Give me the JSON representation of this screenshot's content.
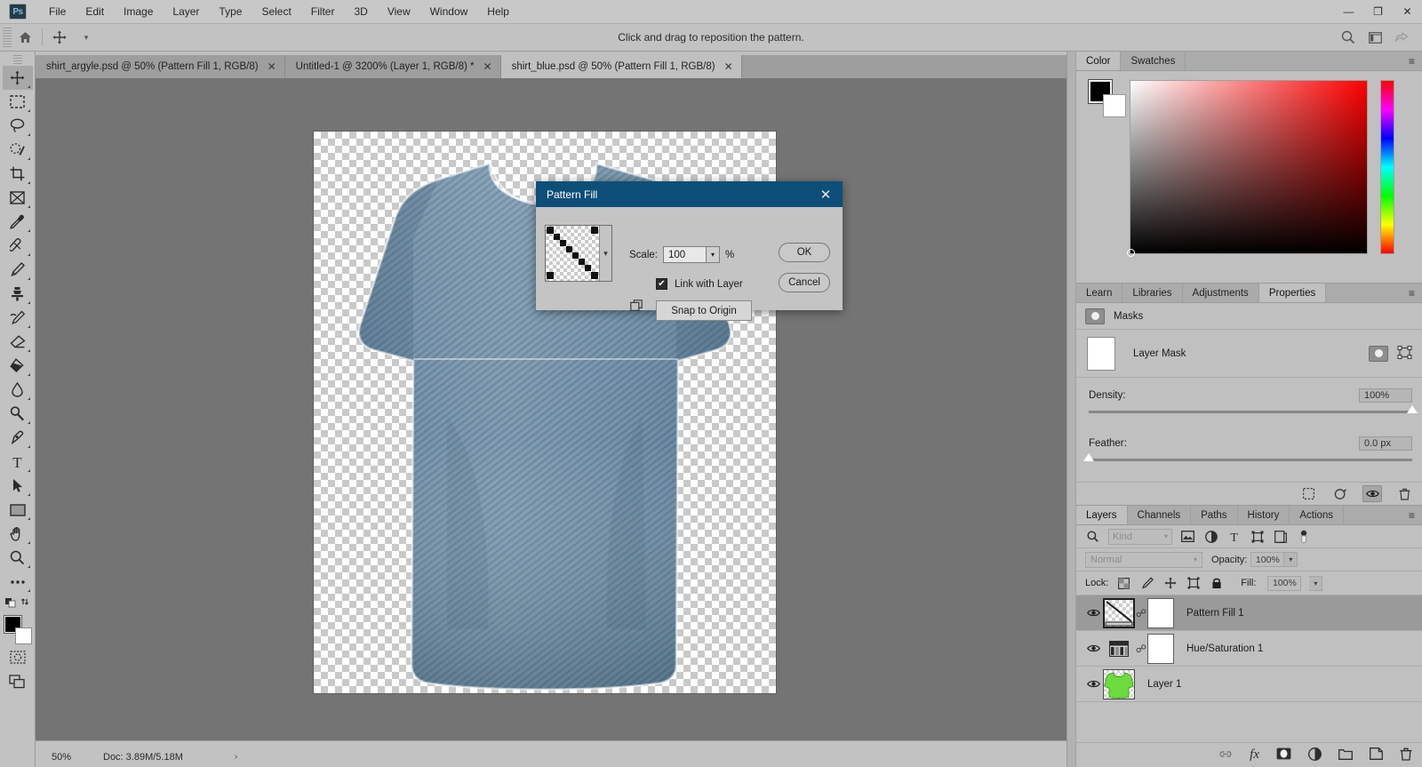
{
  "app": {
    "logo": "Ps",
    "menus": [
      "File",
      "Edit",
      "Image",
      "Layer",
      "Type",
      "Select",
      "Filter",
      "3D",
      "View",
      "Window",
      "Help"
    ],
    "window_controls": [
      {
        "name": "minimize",
        "glyph": "—"
      },
      {
        "name": "restore",
        "glyph": "❐"
      },
      {
        "name": "close",
        "glyph": "✕"
      }
    ]
  },
  "options_bar": {
    "home_icon": "home-icon",
    "tool_icon": "move-tool-icon",
    "tool_caret": "▾",
    "hint": "Click and drag to reposition the pattern.",
    "right_icons": [
      "search-icon",
      "workspace-icon",
      "share-icon"
    ]
  },
  "tabs": [
    {
      "label": "shirt_argyle.psd @ 50% (Pattern Fill 1, RGB/8)",
      "close": "✕",
      "active": false
    },
    {
      "label": "Untitled-1 @ 3200% (Layer 1, RGB/8) *",
      "close": "✕",
      "active": false
    },
    {
      "label": "shirt_blue.psd @ 50% (Pattern Fill 1, RGB/8)",
      "close": "✕",
      "active": true
    }
  ],
  "toolbar": {
    "tools": [
      {
        "name": "move-tool",
        "selected": true
      },
      {
        "name": "rectangular-marquee-tool",
        "selected": false
      },
      {
        "name": "lasso-tool",
        "selected": false
      },
      {
        "name": "quick-selection-tool",
        "selected": false
      },
      {
        "name": "crop-tool",
        "selected": false
      },
      {
        "name": "frame-tool",
        "selected": false
      },
      {
        "name": "eyedropper-tool",
        "selected": false
      },
      {
        "name": "spot-healing-brush-tool",
        "selected": false
      },
      {
        "name": "brush-tool",
        "selected": false
      },
      {
        "name": "clone-stamp-tool",
        "selected": false
      },
      {
        "name": "history-brush-tool",
        "selected": false
      },
      {
        "name": "eraser-tool",
        "selected": false
      },
      {
        "name": "gradient-tool",
        "selected": false
      },
      {
        "name": "blur-tool",
        "selected": false
      },
      {
        "name": "dodge-tool",
        "selected": false
      },
      {
        "name": "pen-tool",
        "selected": false
      },
      {
        "name": "type-tool",
        "selected": false
      },
      {
        "name": "path-selection-tool",
        "selected": false
      },
      {
        "name": "rectangle-tool",
        "selected": false
      },
      {
        "name": "hand-tool",
        "selected": false
      },
      {
        "name": "zoom-tool",
        "selected": false
      },
      {
        "name": "edit-toolbar-tool",
        "selected": false
      }
    ],
    "foreground_color": "#000000",
    "background_color": "#ffffff"
  },
  "canvas": {
    "document": "shirt_blue.psd",
    "shirt_color": "#6d8ba3",
    "shirt_shadow": "#4f6d84",
    "transparency_checker_light": "#ffffff",
    "transparency_checker_dark": "#c9c9c9"
  },
  "status_bar": {
    "zoom": "50%",
    "doc_info": "Doc: 3.89M/5.18M",
    "arrow": "›"
  },
  "dialog": {
    "title": "Pattern Fill",
    "close": "✕",
    "pattern_caret": "▾",
    "scale_label": "Scale:",
    "scale_value": "100",
    "scale_caret": "▾",
    "percent": "%",
    "link_checkbox_glyph": "✔",
    "link_label": "Link with Layer",
    "snap_button": "Snap to Origin",
    "ok_button": "OK",
    "cancel_button": "Cancel",
    "title_bg": "#0d4f78"
  },
  "color_panel": {
    "tabs": [
      {
        "label": "Color",
        "active": true
      },
      {
        "label": "Swatches",
        "active": false
      }
    ],
    "menu_glyph": "≡",
    "foreground": "#000000",
    "background": "#ffffff",
    "field_hue": "#ff0000"
  },
  "properties_panel": {
    "tabs": [
      {
        "label": "Learn",
        "active": false
      },
      {
        "label": "Libraries",
        "active": false
      },
      {
        "label": "Adjustments",
        "active": false
      },
      {
        "label": "Properties",
        "active": true
      }
    ],
    "menu_glyph": "≡",
    "header": "Masks",
    "mask_label": "Layer Mask",
    "density": {
      "label": "Density:",
      "value": "100%",
      "percent": 100
    },
    "feather": {
      "label": "Feather:",
      "value": "0.0 px",
      "percent": 0
    },
    "footer_icons": [
      "select-mask-icon",
      "apply-mask-icon",
      "toggle-mask-visibility-icon",
      "delete-mask-icon"
    ]
  },
  "layers_panel": {
    "tabs": [
      {
        "label": "Layers",
        "active": true
      },
      {
        "label": "Channels",
        "active": false
      },
      {
        "label": "Paths",
        "active": false
      },
      {
        "label": "History",
        "active": false
      },
      {
        "label": "Actions",
        "active": false
      }
    ],
    "menu_glyph": "≡",
    "filter_placeholder": "Kind",
    "filter_caret": "▾",
    "filter_icons": [
      "pixel-filter-icon",
      "adjustment-filter-icon",
      "type-filter-icon",
      "shape-filter-icon",
      "smart-object-filter-icon",
      "filter-toggle-icon"
    ],
    "blend_mode": "Normal",
    "blend_caret": "▾",
    "opacity_label": "Opacity:",
    "opacity_value": "100%",
    "lock_label": "Lock:",
    "lock_icons": [
      "lock-transparent-pixels-icon",
      "lock-image-pixels-icon",
      "lock-position-icon",
      "lock-artboard-icon",
      "lock-all-icon"
    ],
    "fill_label": "Fill:",
    "fill_value": "100%",
    "layers": [
      {
        "name": "Pattern Fill 1",
        "visible": true,
        "selected": true,
        "has_mask": true,
        "thumb": "pattern-fill-thumbnail"
      },
      {
        "name": "Hue/Saturation 1",
        "visible": true,
        "selected": false,
        "has_mask": true,
        "thumb": "hue-saturation-thumbnail"
      },
      {
        "name": "Layer 1",
        "visible": true,
        "selected": false,
        "has_mask": false,
        "thumb": "shirt-thumbnail"
      }
    ],
    "footer_icons": [
      "link-layers-icon",
      "layer-style-fx-icon",
      "add-mask-icon",
      "adjustment-layer-icon",
      "new-group-icon",
      "new-layer-icon",
      "delete-layer-icon"
    ],
    "fx_label": "fx"
  }
}
